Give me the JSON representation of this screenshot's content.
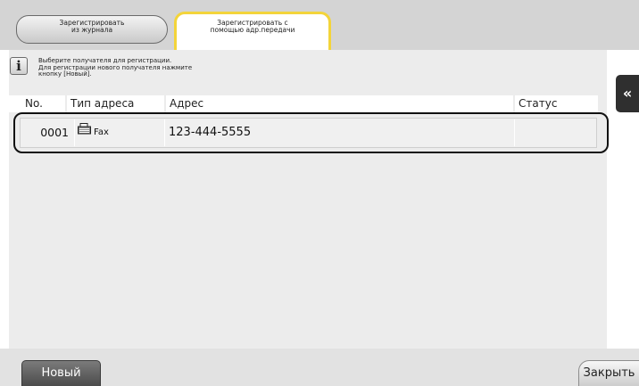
{
  "tabs": [
    {
      "line1": "Зарегистрировать",
      "line2": "из журнала"
    },
    {
      "line1": "Зарегистрировать с",
      "line2": "помощью адр.передачи"
    }
  ],
  "info": {
    "icon": "info-icon",
    "lines": [
      "Выберите получателя для регистрации.",
      "Для регистрации нового получателя нажмите",
      "кнопку [Новый]."
    ]
  },
  "table": {
    "columns": [
      "No.",
      "Тип адреса",
      "Адрес",
      "Статус"
    ],
    "rows": [
      {
        "no": "0001",
        "type_icon": "fax-icon",
        "type": "Fax",
        "address": "123-444-5555",
        "status": ""
      }
    ]
  },
  "side_panel": {
    "glyph": "«",
    "icon": "collapse-panel-icon"
  },
  "buttons": {
    "new": "Новый",
    "close": "Закрыть"
  },
  "colors": {
    "tab_active_border": "#f3d43a",
    "dark_button": "#4b4b4b",
    "panel": "#ececec"
  }
}
